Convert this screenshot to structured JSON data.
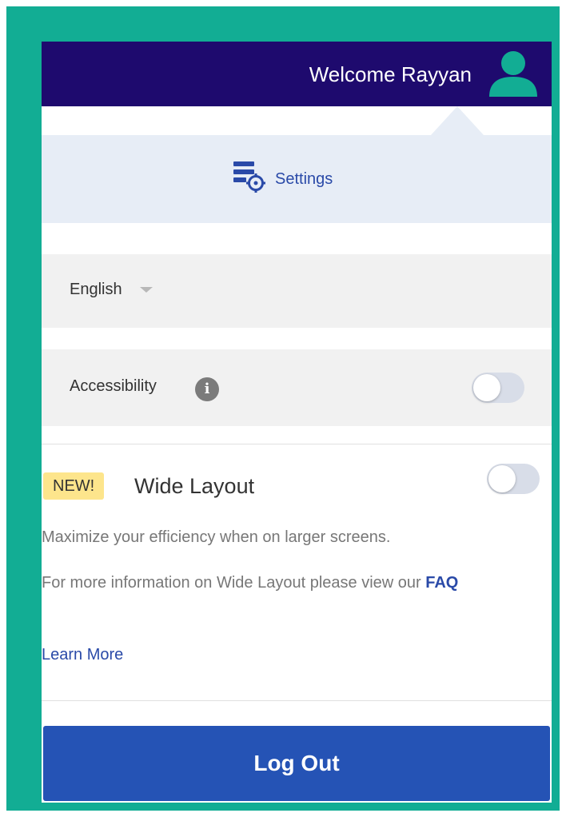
{
  "header": {
    "welcome_text": "Welcome Rayyan",
    "avatar_icon": "user-icon"
  },
  "settings": {
    "label": "Settings",
    "icon": "settings-list-gear-icon"
  },
  "language": {
    "selected": "English",
    "icon": "dropdown-caret-icon"
  },
  "accessibility": {
    "label": "Accessibility",
    "info_glyph": "i",
    "toggle_on": false
  },
  "wide_layout": {
    "badge": "NEW!",
    "title": "Wide Layout",
    "description": "Maximize your efficiency when on larger screens.",
    "info_text": "For more information on Wide Layout please view our ",
    "faq_link": "FAQ",
    "learn_more": "Learn More",
    "toggle_on": false
  },
  "logout": {
    "label": "Log Out"
  },
  "colors": {
    "frame": "#12ad94",
    "header": "#1e0a6e",
    "accent": "#2553b5",
    "link": "#2a4aa8",
    "badge": "#fde58c"
  }
}
